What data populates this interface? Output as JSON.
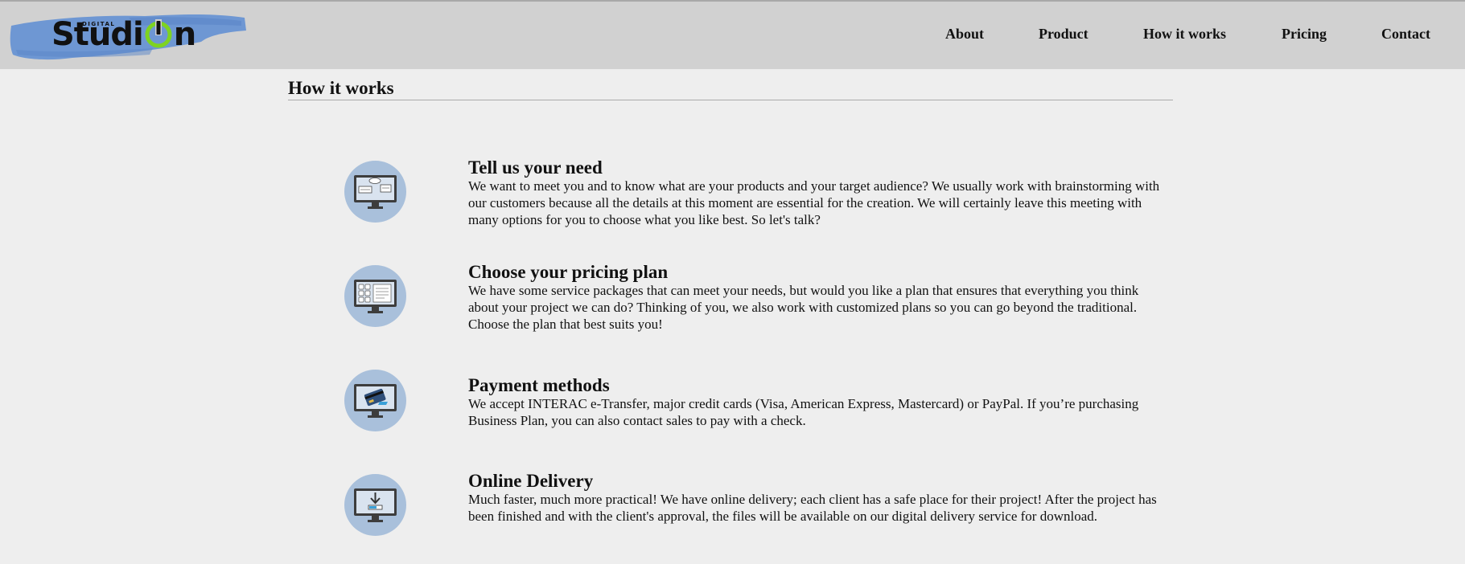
{
  "header": {
    "logo": {
      "text": "Studi",
      "text_end": "n",
      "small_text": "DIGITAL",
      "brush_color": "#6e97d3",
      "power_color": "#7ed321"
    },
    "nav": [
      {
        "label": "About"
      },
      {
        "label": "Product"
      },
      {
        "label": "How it works"
      },
      {
        "label": "Pricing"
      },
      {
        "label": "Contact"
      }
    ]
  },
  "main": {
    "title": "How it works",
    "steps": [
      {
        "icon": "monitor-chat-icon",
        "title": "Tell us your need",
        "body": "We want to meet you and to know what are your products and your target audience? We usually work with brainstorming with our customers because all the details at this moment are essential for the creation. We will certainly leave this meeting with many options for you to choose what you like best. So let's talk?"
      },
      {
        "icon": "monitor-layout-icon",
        "title": "Choose your pricing plan",
        "body": "We have some service packages that can meet your needs, but would you like a plan that ensures that everything you think about your project we can do? Thinking of you, we also work with customized plans so you can go beyond the traditional. Choose the plan that best suits you!"
      },
      {
        "icon": "monitor-credit-card-icon",
        "title": "Payment methods",
        "body": "We accept INTERAC e-Transfer, major credit cards (Visa, American Express, Mastercard) or PayPal. If you’re purchasing Business Plan, you can also contact sales to pay with a check."
      },
      {
        "icon": "monitor-download-icon",
        "title": "Online Delivery",
        "body": "Much faster, much more practical! We have online delivery; each client has a safe place for their project! After the project has been finished and with the client's approval, the files will be available on our digital delivery service for download."
      }
    ],
    "icon_circle_color": "#a9c0db"
  }
}
